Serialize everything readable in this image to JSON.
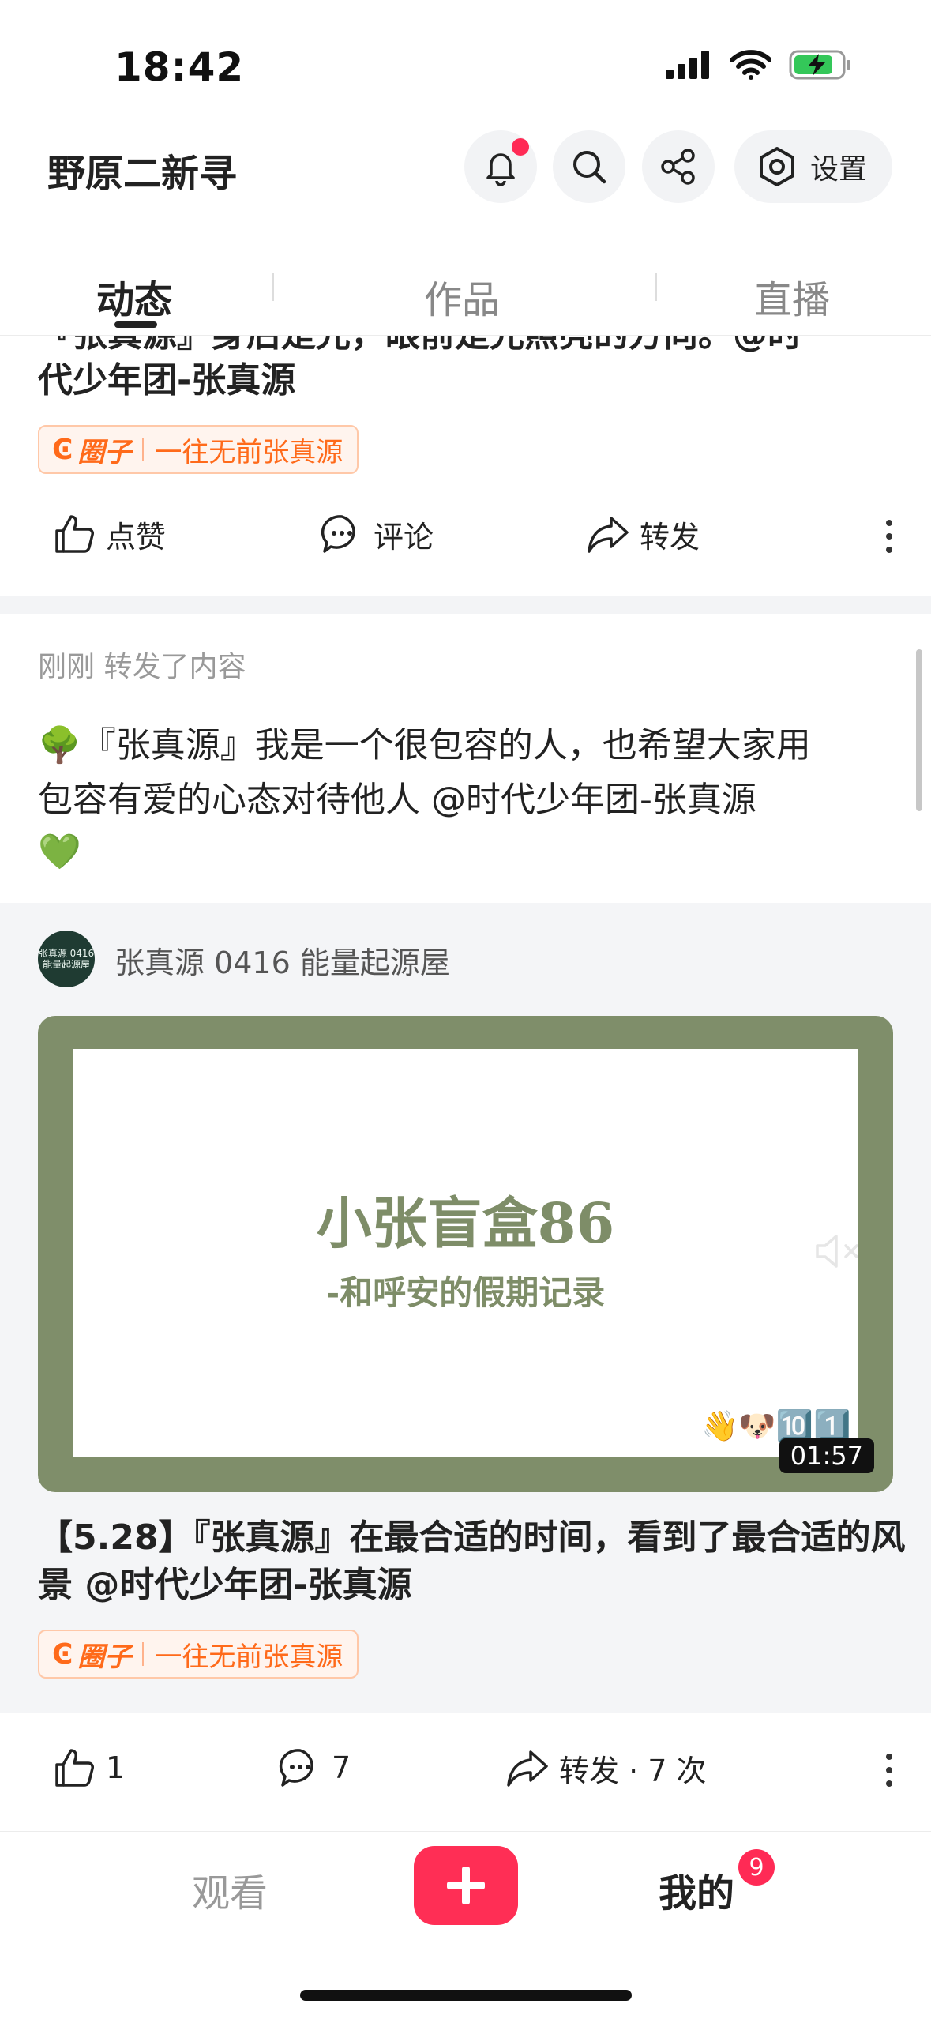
{
  "status_bar": {
    "time": "18:42"
  },
  "header": {
    "title": "野原二新寻",
    "settings_label": "设置"
  },
  "tabs": [
    {
      "label": "动态"
    },
    {
      "label": "作品"
    },
    {
      "label": "直播"
    }
  ],
  "post1": {
    "text_partial_top": "『张真源』身后是光，眼前是光照亮的方向。@时",
    "text_line2": "代少年团-张真源",
    "circle_label": "圈子",
    "circle_name": "一往无前张真源",
    "like_label": "点赞",
    "comment_label": "评论",
    "share_label": "转发"
  },
  "post2": {
    "meta": "刚刚 转发了内容",
    "text_line1": "🌳『张真源』我是一个很包容的人，也希望大家用",
    "text_line2": "包容有爱的心态对待他人 @时代少年团-张真源",
    "text_line3": "💚",
    "repost": {
      "author": "张真源 0416 能量起源屋",
      "avatar_text": "张真源 0416 能量起源屋",
      "video_title": "小张盲盒86",
      "video_subtitle": "-和呼安的假期记录",
      "video_emojis": "👋🐶🔟1️⃣",
      "duration": "01:57",
      "caption_line1": "【5.28】『张真源』在最合适的时间，看到了最合适的风",
      "caption_line2": "景 @时代少年团-张真源",
      "circle_label": "圈子",
      "circle_name": "一往无前张真源"
    },
    "like_count": "1",
    "comment_count": "7",
    "share_label": "转发 · 7 次"
  },
  "bottom_nav": {
    "watch": "观看",
    "mine": "我的",
    "badge": "9"
  },
  "colors": {
    "accent": "#ff2e55",
    "tag": "#ff6a1a",
    "video_bg": "#7f8e6a"
  }
}
